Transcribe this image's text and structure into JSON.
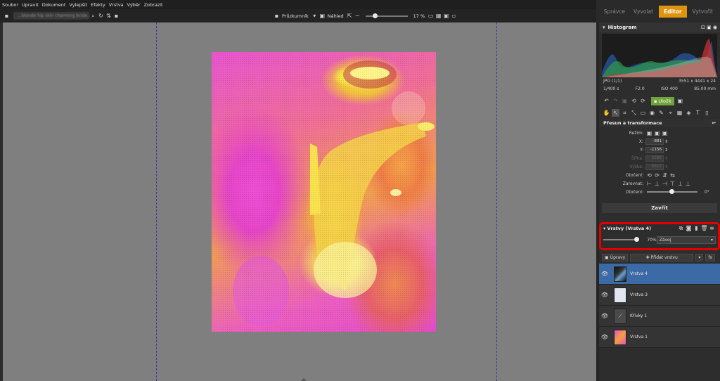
{
  "menu": [
    "Soubor",
    "Upravit",
    "Dokument",
    "Vylepšit",
    "Efekty",
    "Vrstva",
    "Výběr",
    "Zobrazit"
  ],
  "toolbar": {
    "path": "...blonde hip skin charming bride...",
    "explorer_label": "Průzkumník",
    "preview_label": "Náhled",
    "zoom": "17 %"
  },
  "modes": {
    "manager": "Správce",
    "develop": "Vyvolat",
    "editor": "Editor",
    "create": "Vytvořit"
  },
  "histogram": {
    "title": "Histogram",
    "format": "JPG",
    "index": "(1/1)",
    "dimensions": "3551 x 4441 x 24",
    "shutter": "1/400 s",
    "aperture": "F2.0",
    "iso": "ISO 400",
    "focal": "85.00 mm"
  },
  "save_label": "Uložit",
  "transform": {
    "title": "Přesun a transformace",
    "mode_label": "Režim:",
    "x_label": "X:",
    "x_value": "-881",
    "y_label": "Y:",
    "y_value": "-1156",
    "width_label": "Šířka:",
    "width_value": "5286",
    "height_label": "Výška:",
    "height_value": "6612",
    "rotate_label": "Otočení:",
    "align_label": "Zarovnat:",
    "rotation_label": "Otočení:",
    "rotation_value": "0°",
    "close_label": "Zavřít"
  },
  "layers_panel": {
    "title": "Vrstvy (Vrstva 4)",
    "opacity": "70%",
    "blend_mode": "Závoj",
    "adjust_label": "Úpravy",
    "add_label": "Přidat vrstvu",
    "fx_label": "fx",
    "layers": [
      {
        "name": "Vrstva 4"
      },
      {
        "name": "Vrstva 3"
      },
      {
        "name": "Křivky 1"
      },
      {
        "name": "Vrstva 1"
      }
    ]
  },
  "colors": {
    "accent": "#e0940e",
    "selected_layer": "#3b6aa6",
    "save": "#6fa43a",
    "highlight_box": "#e00000"
  }
}
